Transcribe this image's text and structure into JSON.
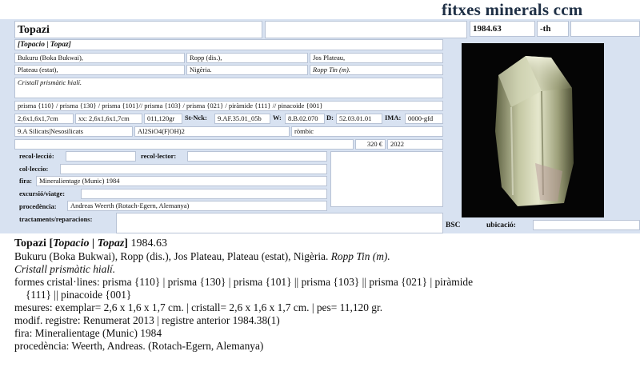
{
  "app": {
    "title": "fitxes minerals ccm"
  },
  "form": {
    "name": "Topazi",
    "number": "1984.63",
    "suffix": "-th",
    "synonyms": "[Topacio | Topaz]",
    "locality": [
      "Bukuru (Boka Bukwai),",
      "Ropp (dis.),",
      "Jos Plateau,",
      "Plateau (estat),",
      "Nigèria.",
      "Ropp Tin (m)."
    ],
    "description": "Cristall prismàtic hialí.",
    "forms": "prisma {110} / prisma {130} / prisma {101}// prisma {103} / prisma {021} / piràmide {111} // pinacoide {001}",
    "size_specimen": "2,6x1,6x1,7cm",
    "size_crystal": "xx: 2,6x1,6x1,7cm",
    "weight": "011,120gr",
    "strunz_label": "St-Nck:",
    "strunz": "9.AF.35.01_05b",
    "w_label": "W:",
    "w": "8.B.02.070",
    "d_label": "D:",
    "d": "52.03.01.01",
    "ima_label": "IMA:",
    "ima": "0000-gfd",
    "class": "9.A Silicats|Nesosilicats",
    "formula": "Al2SiO4(F|OH)2",
    "system": "ròmbic",
    "price": "320 €",
    "year": "2022",
    "recolleccio_label": "recol·lecció:",
    "recollector_label": "recol·lector:",
    "colleccio_label": "col·leccio:",
    "fira_label": "fira:",
    "fira": "Mineralientage (Munic) 1984",
    "excursio_label": "excursió/viatge:",
    "procedencia_label": "procedència:",
    "procedencia": "Andreas Weerth (Rotach-Egern, Alemanya)",
    "tractaments_label": "tractaments/reparacions:",
    "bsc_label": "BSC",
    "ubicacio_label": "ubicació:"
  },
  "record": {
    "name": "Topazi",
    "synonyms": "Topacio | Topaz",
    "number": "1984.63",
    "locality": "Bukuru (Boka Bukwai), Ropp (dis.), Jos Plateau, Plateau (estat), Nigèria.",
    "mine": "Ropp Tin (m).",
    "description": "Cristall prismàtic hialí.",
    "forms_line1": "formes cristal·lines: prisma {110} | prisma {130} | prisma {101} || prisma {103} || prisma {021} | piràmide",
    "forms_line2": "{111} || pinacoide {001}",
    "measures": "mesures: exemplar= 2,6 x 1,6 x 1,7 cm. | cristall= 2,6 x 1,6 x 1,7 cm. | pes= 11,120 gr.",
    "register": "modif. registre: Renumerat 2013 | registre anterior 1984.38(1)",
    "fair": "fira: Mineralientage (Munic) 1984",
    "provenance": "procedència: Weerth, Andreas. (Rotach-Egern, Alemanya)"
  }
}
